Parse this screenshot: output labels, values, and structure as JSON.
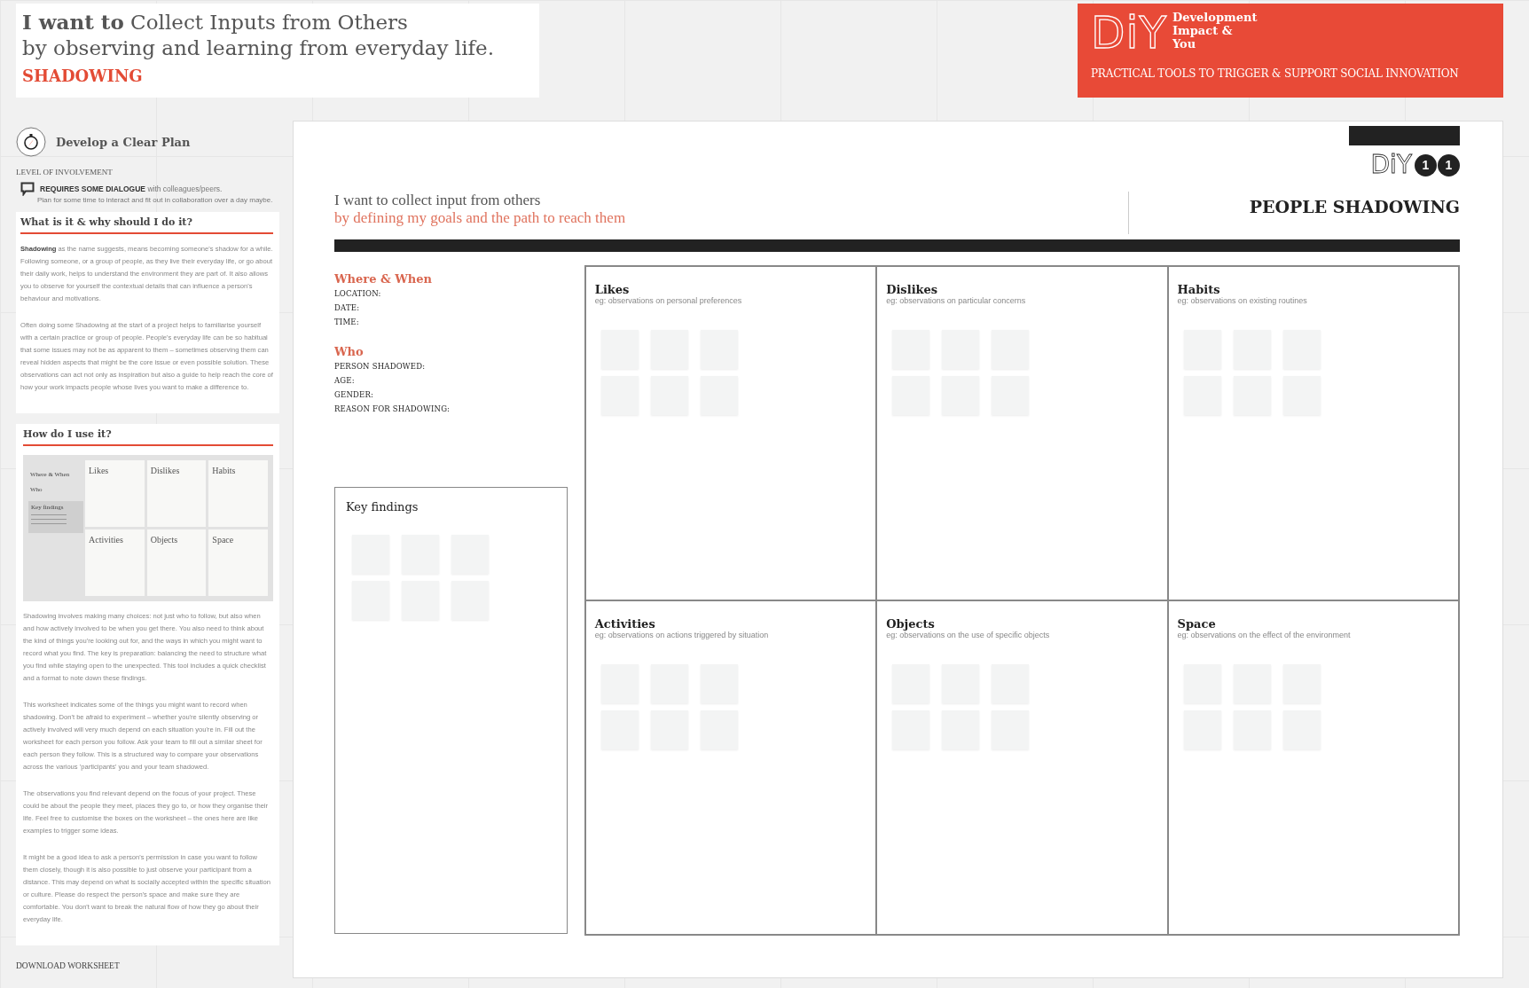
{
  "header": {
    "title": "**I want to** Collect Inputs from Others",
    "subtitle": "by observing and learning from everyday life.",
    "method": "SHADOWING"
  },
  "banner": {
    "logo": "DiY",
    "name_lines": [
      "Development",
      "Impact &",
      "You"
    ],
    "tagline": "PRACTICAL TOOLS TO TRIGGER & SUPPORT SOCIAL INNOVATION"
  },
  "sidebar": {
    "goal": "Develop a Clear Plan",
    "involvement_label": "LEVEL OF INVOLVEMENT",
    "involvement": "**REQUIRES SOME DIALOGUE** with colleagues/peers.",
    "involvement_note": "Plan for some time to interact and fit out in collaboration over a day maybe.",
    "what": {
      "title": "What is it & why should I do it?",
      "paragraphs": [
        "**Shadowing** as the name suggests, means becoming someone's shadow for a while. Following someone, or a group of people, as they live their everyday life, or go about their daily work, helps to understand the environment they are part of. It also allows you to observe for yourself the contextual details that can influence a person's behaviour and motivations.",
        "Often doing some Shadowing at the start of a project helps to familiarise yourself with a certain practice or group of people. People's everyday life can be so habitual that some issues may not be as apparent to them – sometimes observing them can reveal hidden aspects that might be the core issue or even possible solution. These observations can act not only as inspiration but also a guide to help reach the core of how your work impacts people whose lives you want to make a difference to."
      ]
    },
    "how": {
      "title": "How do I use it?",
      "diagram": {
        "side": [
          "Where & When",
          "Who"
        ],
        "key": "Key findings",
        "cells": [
          "Likes",
          "Dislikes",
          "Habits",
          "Activities",
          "Objects",
          "Space"
        ]
      },
      "paragraphs": [
        "Shadowing involves making many choices: not just who to follow, but also when and how actively involved to be when you get there. You also need to think about the kind of things you're looking out for, and the ways in which you might want to record what you find. The key is preparation: balancing the need to structure what you find while staying open to the unexpected. This tool includes a quick checklist and a format to note down these findings.",
        "This worksheet indicates some of the things you might want to record when shadowing. Don't be afraid to experiment – whether you're silently observing or actively involved will very much depend on each situation you're in. Fill out the worksheet for each person you follow. Ask your team to fill out a similar sheet for each person they follow. This is a structured way to compare your observations across the various 'participants' you and your team shadowed.",
        "The observations you find relevant depend on the focus of your project. These could be about the people they meet, places they go to, or how they organise their life. Feel free to customise the boxes on the worksheet – the ones here are like examples to trigger some ideas.",
        "It might be a good idea to ask a person's permission in case you want to follow them closely, though it is also possible to just observe your participant from a distance. This may depend on what is socially accepted within the specific situation or culture. Please do respect the person's space and make sure they are comfortable. You don't want to break the natural flow of how they go about their everyday life."
      ]
    },
    "download": "DOWNLOAD WORKSHEET"
  },
  "worksheet": {
    "intro": "I want to collect input from others",
    "intro_goal": "by defining my goals and the path to reach them",
    "logo": "DiY",
    "numbers": [
      "1",
      "1"
    ],
    "title": "PEOPLE SHADOWING",
    "form": [
      {
        "heading": "Where & When",
        "fields": [
          "LOCATION:",
          "DATE:",
          "TIME:"
        ]
      },
      {
        "heading": "Who",
        "fields": [
          "PERSON SHADOWED:",
          "AGE:",
          "GENDER:",
          "REASON FOR SHADOWING:"
        ]
      }
    ],
    "key_findings": "Key findings",
    "boxes": [
      {
        "title": "Likes",
        "hint": "eg: observations on personal preferences"
      },
      {
        "title": "Dislikes",
        "hint": "eg: observations on particular concerns"
      },
      {
        "title": "Habits",
        "hint": "eg: observations on existing routines"
      },
      {
        "title": "Activities",
        "hint": "eg: observations on actions triggered by situation"
      },
      {
        "title": "Objects",
        "hint": "eg: observations on the use of specific objects"
      },
      {
        "title": "Space",
        "hint": "eg: observations on the effect of the environment"
      }
    ]
  }
}
